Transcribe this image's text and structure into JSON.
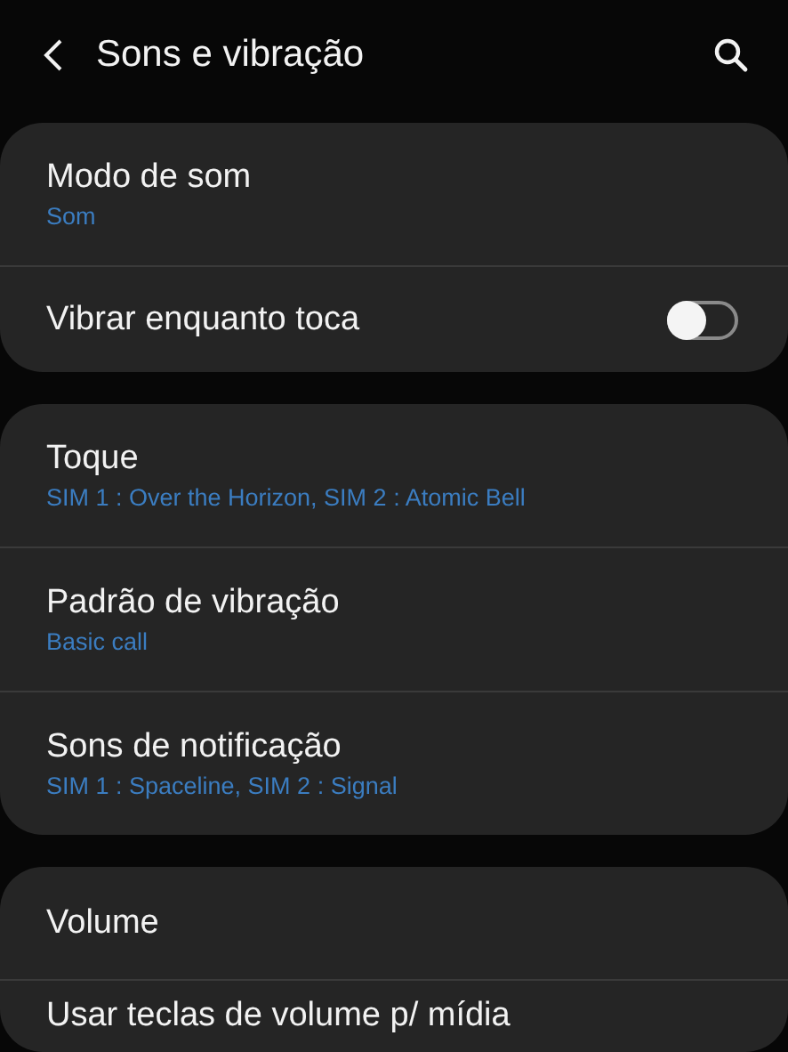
{
  "header": {
    "title": "Sons e vibração"
  },
  "groups": [
    {
      "items": [
        {
          "kind": "summary",
          "title": "Modo de som",
          "summary": "Som"
        },
        {
          "kind": "switch",
          "title": "Vibrar enquanto toca",
          "on": false
        }
      ]
    },
    {
      "items": [
        {
          "kind": "summary",
          "title": "Toque",
          "summary": "SIM 1 : Over the Horizon, SIM 2 : Atomic Bell"
        },
        {
          "kind": "summary",
          "title": "Padrão de vibração",
          "summary": "Basic call"
        },
        {
          "kind": "summary",
          "title": "Sons de notificação",
          "summary": "SIM 1 : Spaceline, SIM 2 : Signal"
        }
      ]
    },
    {
      "items": [
        {
          "kind": "plain",
          "title": "Volume"
        },
        {
          "kind": "plain",
          "title": "Usar teclas de volume p/ mídia"
        }
      ]
    }
  ]
}
